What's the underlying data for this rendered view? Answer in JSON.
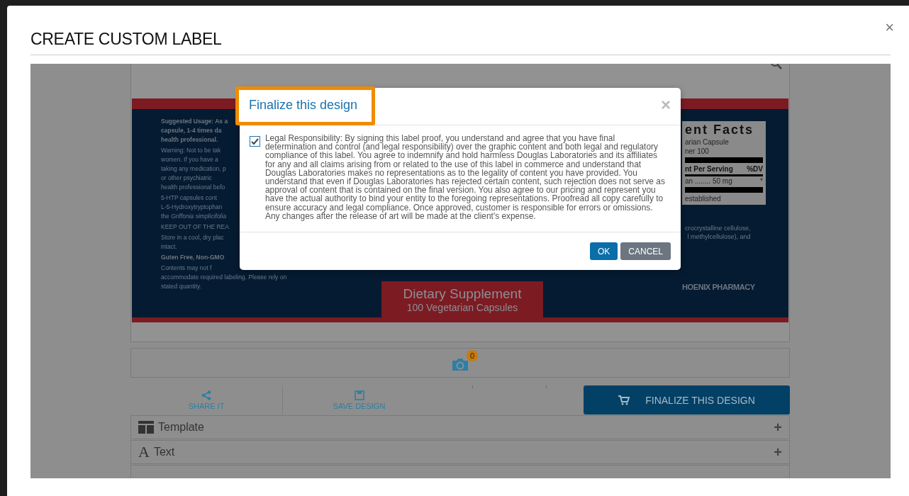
{
  "page": {
    "title": "CREATE CUSTOM LABEL",
    "close": "×"
  },
  "label_preview": {
    "left_lines": [
      {
        "text": "Suggested Usage: As a",
        "kind": "bold"
      },
      {
        "text": "capsule, 1-4 times da",
        "kind": "bold"
      },
      {
        "text": "health professional.",
        "kind": "bold"
      },
      {
        "text": "Warning: Not to be tak",
        "kind": "normal"
      },
      {
        "text": "women. If you have a",
        "kind": "normal"
      },
      {
        "text": "taking any medication, p",
        "kind": "normal"
      },
      {
        "text": "or other psychiatric",
        "kind": "normal"
      },
      {
        "text": "health professional befo",
        "kind": "normal"
      },
      {
        "text": "5-HTP capsules cont",
        "kind": "normal"
      },
      {
        "text": "L-5-Hydroxytryptophan",
        "kind": "normal"
      },
      {
        "text": "the *Griffonia simplicifolia*",
        "kind": "normal"
      },
      {
        "text": "KEEP OUT OF THE REA",
        "kind": "normal"
      },
      {
        "text": "Store in a cool, dry plac",
        "kind": "normal"
      },
      {
        "text": "intact.",
        "kind": "normal"
      },
      {
        "text": "Guten Free, Non-GMO",
        "kind": "bold"
      },
      {
        "text": "Contents may not f",
        "kind": "normal"
      },
      {
        "text": "accommodate required labeling. Please rely on",
        "kind": "normal"
      },
      {
        "text": "stated quantity.",
        "kind": "normal"
      }
    ],
    "facts": {
      "title": "ent Facts",
      "serving": "arian Capsule",
      "per_container": "ner 100",
      "header": "nt Per Serving",
      "dv": "%DV",
      "amount": "an ........ 50 mg",
      "star": "*",
      "footnote": "established"
    },
    "ingredients": [
      "crocrystalline cellulose,",
      "l methylcellulose), and"
    ],
    "pharmacy": "HOENIX PHARMACY",
    "product": {
      "name": "Dietary Supplement",
      "count": "100 Vegetarian Capsules"
    }
  },
  "photos": {
    "count": "0"
  },
  "actions": [
    {
      "label": "SHARE IT",
      "kind": "share"
    },
    {
      "label": "SAVE DESIGN",
      "kind": "save"
    }
  ],
  "finalize_button": "FINALIZE THIS DESIGN",
  "sections": [
    {
      "label": "Template",
      "kind": "grid",
      "expand": "+"
    },
    {
      "label": "Text",
      "kind": "glyph",
      "glyph": "A",
      "expand": "+"
    }
  ],
  "dialog": {
    "title": "Finalize this design",
    "highlighted": true,
    "close": "×",
    "agreement": {
      "checked": true,
      "text": "Legal Responsibility: By signing this label proof, you understand and agree that you have final determination and control (and legal responsibility) over the graphic content and both legal and regulatory compliance of this label. You agree to indemnify and hold harmless Douglas Laboratories and its affiliates for any and all claims arising from or related to the use of this label in commerce and understand that Douglas Laboratories makes no representations as to the legality of content you have provided. You understand that even if Douglas Laboratories has rejected certain content, such rejection does not serve as approval of content that is contained on the final version. You also agree to our pricing and represent you have the actual authority to bind your entity to the foregoing representations. Proofread all copy carefully to ensure accuracy and legal compliance. Once approved, customer is responsible for errors or omissions. Any changes after the release of art will be made at the client's expense."
    },
    "buttons": [
      {
        "label": "OK",
        "kind": "primary"
      },
      {
        "label": "CANCEL",
        "kind": "secondary"
      }
    ]
  }
}
